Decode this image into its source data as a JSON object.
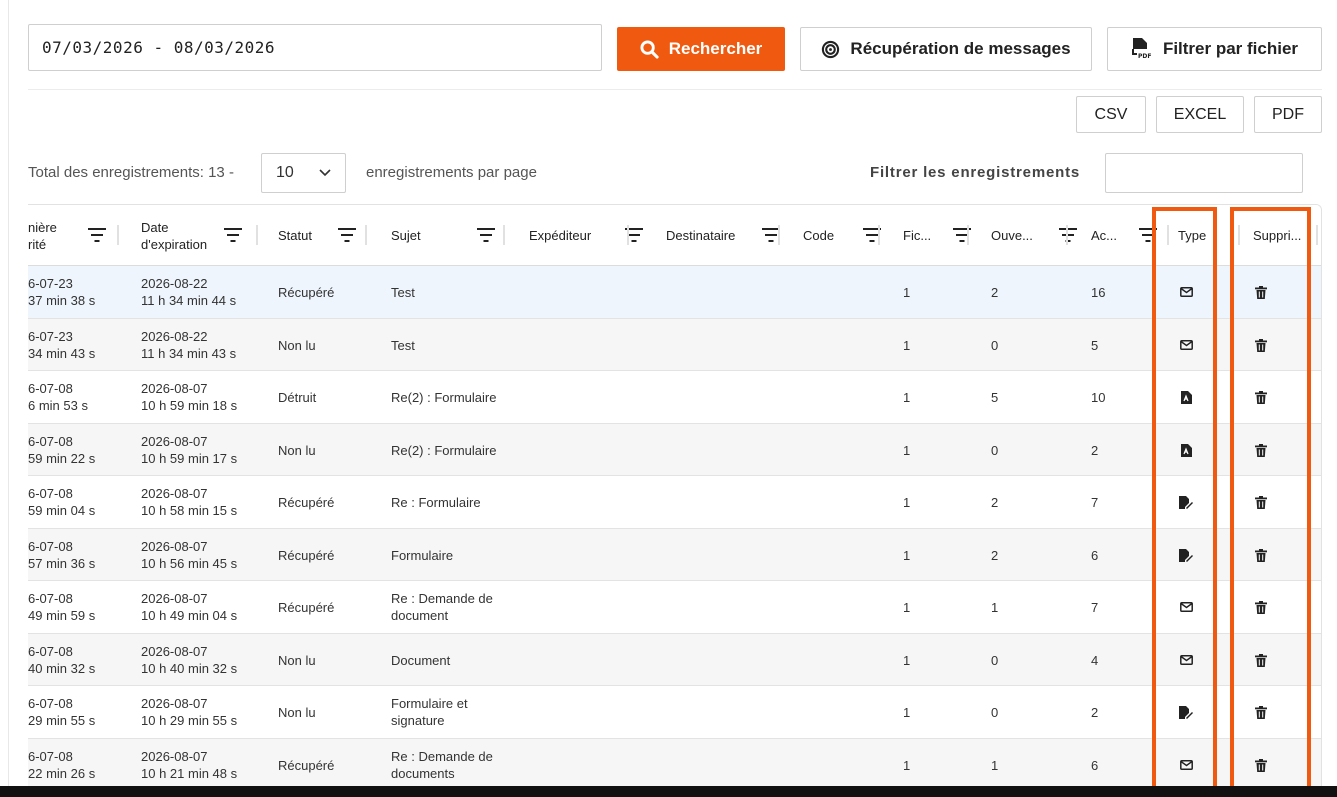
{
  "search": {
    "date_range": "07/03/2026 - 08/03/2026",
    "search_label": "Rechercher",
    "recup_label": "Récupération de messages",
    "filter_file_label": "Filtrer par fichier"
  },
  "export": {
    "csv": "CSV",
    "excel": "EXCEL",
    "pdf": "PDF"
  },
  "controls": {
    "total_text": "Total des enregistrements: 13 -",
    "per_page_value": "10",
    "per_page_text": "enregistrements par page",
    "filter_label": "Filtrer les enregistrements",
    "filter_value": ""
  },
  "columns": [
    {
      "key": "premiere",
      "label1": "nière",
      "label2": "rité"
    },
    {
      "key": "expiration",
      "label1": "Date",
      "label2": "d'expiration"
    },
    {
      "key": "statut",
      "label1": "Statut",
      "label2": ""
    },
    {
      "key": "sujet",
      "label1": "Sujet",
      "label2": ""
    },
    {
      "key": "expediteur",
      "label1": "Expéditeur",
      "label2": ""
    },
    {
      "key": "destinataire",
      "label1": "Destinataire",
      "label2": ""
    },
    {
      "key": "code",
      "label1": "Code",
      "label2": ""
    },
    {
      "key": "fichiers",
      "label1": "Fic...",
      "label2": ""
    },
    {
      "key": "ouvertures",
      "label1": "Ouve...",
      "label2": ""
    },
    {
      "key": "acces",
      "label1": "Ac...",
      "label2": ""
    },
    {
      "key": "type",
      "label1": "Type",
      "label2": ""
    },
    {
      "key": "supprimer",
      "label1": "Suppri...",
      "label2": ""
    }
  ],
  "rows": [
    {
      "c1a": "6-07-23",
      "c1b": "37 min 38 s",
      "c2a": "2026-08-22",
      "c2b": "11 h 34 min 44 s",
      "statut": "Récupéré",
      "sujet1": "Test",
      "sujet2": "",
      "fic": "1",
      "ouv": "2",
      "acc": "16",
      "type": "envelope"
    },
    {
      "c1a": "6-07-23",
      "c1b": "34 min 43 s",
      "c2a": "2026-08-22",
      "c2b": "11 h 34 min 43 s",
      "statut": "Non lu",
      "sujet1": "Test",
      "sujet2": "",
      "fic": "1",
      "ouv": "0",
      "acc": "5",
      "type": "envelope"
    },
    {
      "c1a": "6-07-08",
      "c1b": "6 min 53 s",
      "c2a": "2026-08-07",
      "c2b": "10 h 59 min 18 s",
      "statut": "Détruit",
      "sujet1": "Re(2) : Formulaire",
      "sujet2": "",
      "fic": "1",
      "ouv": "5",
      "acc": "10",
      "type": "pdf-file"
    },
    {
      "c1a": "6-07-08",
      "c1b": "59 min 22 s",
      "c2a": "2026-08-07",
      "c2b": "10 h 59 min 17 s",
      "statut": "Non lu",
      "sujet1": "Re(2) : Formulaire",
      "sujet2": "",
      "fic": "1",
      "ouv": "0",
      "acc": "2",
      "type": "pdf-file"
    },
    {
      "c1a": "6-07-08",
      "c1b": "59 min 04 s",
      "c2a": "2026-08-07",
      "c2b": "10 h 58 min 15 s",
      "statut": "Récupéré",
      "sujet1": "Re : Formulaire",
      "sujet2": "",
      "fic": "1",
      "ouv": "2",
      "acc": "7",
      "type": "signature-file"
    },
    {
      "c1a": "6-07-08",
      "c1b": "57 min 36 s",
      "c2a": "2026-08-07",
      "c2b": "10 h 56 min 45 s",
      "statut": "Récupéré",
      "sujet1": "Formulaire",
      "sujet2": "",
      "fic": "1",
      "ouv": "2",
      "acc": "6",
      "type": "signature-file"
    },
    {
      "c1a": "6-07-08",
      "c1b": "49 min 59 s",
      "c2a": "2026-08-07",
      "c2b": "10 h 49 min 04 s",
      "statut": "Récupéré",
      "sujet1": "Re : Demande de",
      "sujet2": "document",
      "fic": "1",
      "ouv": "1",
      "acc": "7",
      "type": "envelope"
    },
    {
      "c1a": "6-07-08",
      "c1b": "40 min 32 s",
      "c2a": "2026-08-07",
      "c2b": "10 h 40 min 32 s",
      "statut": "Non lu",
      "sujet1": "Document",
      "sujet2": "",
      "fic": "1",
      "ouv": "0",
      "acc": "4",
      "type": "envelope"
    },
    {
      "c1a": "6-07-08",
      "c1b": "29 min 55 s",
      "c2a": "2026-08-07",
      "c2b": "10 h 29 min 55 s",
      "statut": "Non lu",
      "sujet1": "Formulaire et",
      "sujet2": "signature",
      "fic": "1",
      "ouv": "0",
      "acc": "2",
      "type": "signature-file"
    },
    {
      "c1a": "6-07-08",
      "c1b": "22 min 26 s",
      "c2a": "2026-08-07",
      "c2b": "10 h 21 min 48 s",
      "statut": "Récupéré",
      "sujet1": "Re : Demande de",
      "sujet2": "documents",
      "fic": "1",
      "ouv": "1",
      "acc": "6",
      "type": "envelope"
    }
  ],
  "colors": {
    "accent": "#f05a10",
    "selected_row": "#eef5fc",
    "alt_row": "#f6f6f6"
  }
}
